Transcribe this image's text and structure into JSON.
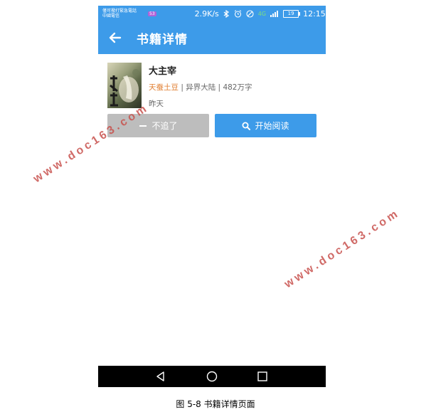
{
  "status_bar": {
    "carrier_line1": "僅可撥打緊急電話",
    "carrier_line2": "中國電信",
    "sim_badge": "53",
    "speed": "2.9K/s",
    "network": "4G",
    "battery": "19",
    "time": "12:15"
  },
  "toolbar": {
    "title": "书籍详情"
  },
  "book": {
    "title": "大主宰",
    "author": "天蚕土豆",
    "separator1": " | ",
    "category": "异界大陆",
    "separator2": " | ",
    "word_count": "482万字",
    "updated": "昨天"
  },
  "actions": {
    "unfollow_label": "不追了",
    "read_label": "开始阅读"
  },
  "caption": "图 5-8  书籍详情页面",
  "watermark": "www.doc163.com",
  "colors": {
    "primary": "#3d9be9",
    "author": "#e07c2c",
    "disabled_button": "#bdbdbd",
    "watermark": "#c8514d"
  }
}
